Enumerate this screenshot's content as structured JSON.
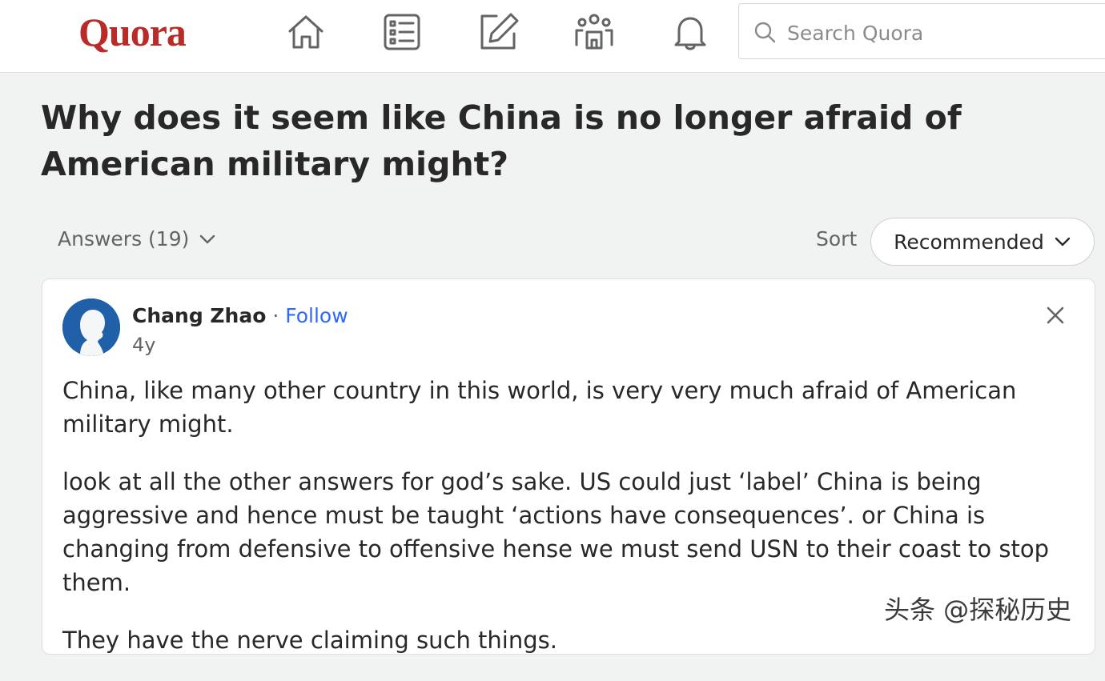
{
  "header": {
    "logo": "Quora",
    "nav": [
      {
        "name": "home-icon"
      },
      {
        "name": "following-icon"
      },
      {
        "name": "answer-icon"
      },
      {
        "name": "spaces-icon"
      },
      {
        "name": "notifications-icon"
      }
    ],
    "search_placeholder": "Search Quora"
  },
  "question": {
    "title": "Why does it seem like China is no longer afraid of American military might?"
  },
  "answers_bar": {
    "answers_label": "Answers (19)",
    "sort_label": "Sort",
    "sort_value": "Recommended"
  },
  "answer": {
    "author": "Chang Zhao",
    "separator": "·",
    "follow_label": "Follow",
    "time": "4y",
    "paragraphs": [
      "China, like many other country in this world, is very very much afraid of American military might.",
      "look at all the other answers for god’s sake. US could just ‘label’ China is being aggressive and hence must be taught ‘actions have consequences’. or China is changing from defensive to offensive hense we must send USN to their coast to stop them.",
      "They have the nerve claiming such things."
    ]
  },
  "watermark": "头条 @探秘历史",
  "colors": {
    "brand": "#b92b27",
    "link": "#2e69ff",
    "avatar": "#1f60a8"
  }
}
